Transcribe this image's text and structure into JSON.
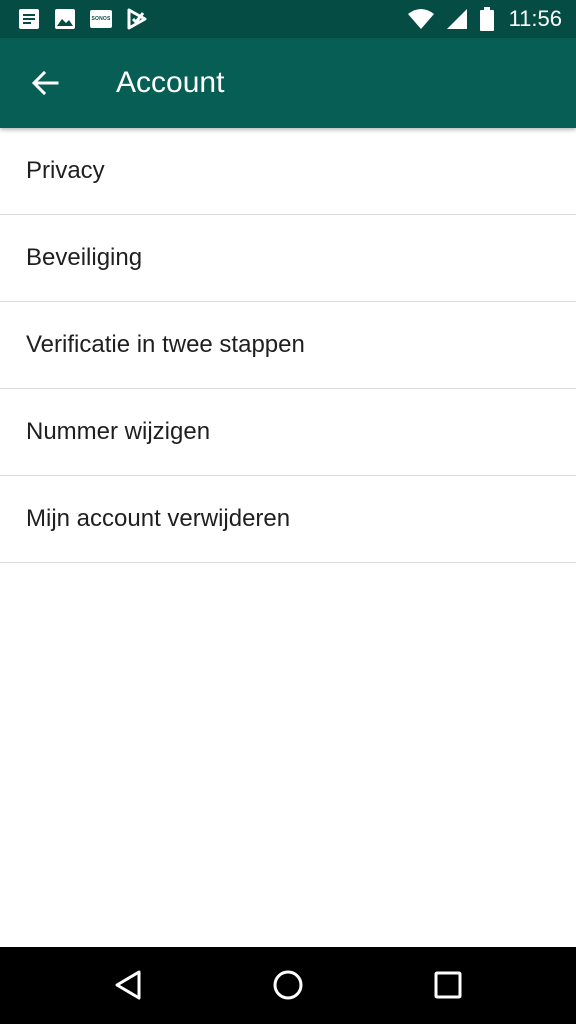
{
  "status_bar": {
    "time": "11:56",
    "sonos_label": "SONOS",
    "icons": [
      "notes-icon",
      "image-icon",
      "sonos-icon",
      "checkmark-app-icon",
      "wifi-icon",
      "signal-icon",
      "battery-icon"
    ]
  },
  "toolbar": {
    "title": "Account",
    "back_icon": "arrow-left-icon"
  },
  "settings": {
    "items": [
      {
        "label": "Privacy"
      },
      {
        "label": "Beveiliging"
      },
      {
        "label": "Verificatie in twee stappen"
      },
      {
        "label": "Nummer wijzigen"
      },
      {
        "label": "Mijn account verwijderen"
      }
    ]
  },
  "nav_bar": {
    "icons": [
      "back-triangle-icon",
      "home-circle-icon",
      "recents-square-icon"
    ]
  },
  "colors": {
    "status_bar": "#054d44",
    "toolbar": "#075e54",
    "divider": "#dcdcdc",
    "text": "#1f1f1f"
  }
}
